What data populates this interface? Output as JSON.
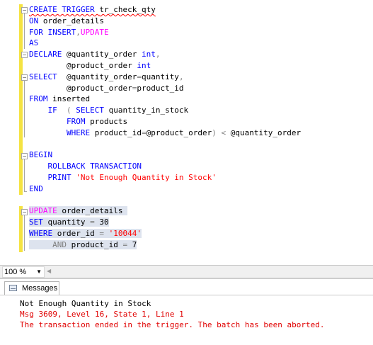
{
  "editor": {
    "lines": [
      [
        {
          "t": "CREATE TRIGGER ",
          "c": "kw",
          "sq": true
        },
        {
          "t": "tr_check_qty",
          "c": "",
          "sq": true
        }
      ],
      [
        {
          "t": "ON ",
          "c": "kw"
        },
        {
          "t": "order_details",
          "c": ""
        }
      ],
      [
        {
          "t": "FOR ",
          "c": "kw"
        },
        {
          "t": "INSERT",
          "c": "kw"
        },
        {
          "t": ",",
          "c": "gray"
        },
        {
          "t": "UPDATE",
          "c": "fn"
        }
      ],
      [
        {
          "t": "AS",
          "c": "kw"
        }
      ],
      [
        {
          "t": "DECLARE ",
          "c": "kw"
        },
        {
          "t": "@quantity_order ",
          "c": ""
        },
        {
          "t": "int",
          "c": "kw"
        },
        {
          "t": ",",
          "c": "gray"
        }
      ],
      [
        {
          "t": "        @product_order ",
          "c": ""
        },
        {
          "t": "int",
          "c": "kw"
        }
      ],
      [
        {
          "t": "SELECT  ",
          "c": "kw"
        },
        {
          "t": "@quantity_order",
          "c": ""
        },
        {
          "t": "=",
          "c": "gray"
        },
        {
          "t": "quantity",
          "c": ""
        },
        {
          "t": ",",
          "c": "gray"
        }
      ],
      [
        {
          "t": "        @product_order",
          "c": ""
        },
        {
          "t": "=",
          "c": "gray"
        },
        {
          "t": "product_id",
          "c": ""
        }
      ],
      [
        {
          "t": "FROM ",
          "c": "kw"
        },
        {
          "t": "inserted",
          "c": ""
        }
      ],
      [
        {
          "t": "    IF  ",
          "c": "kw"
        },
        {
          "t": "( ",
          "c": "gray"
        },
        {
          "t": "SELECT ",
          "c": "kw"
        },
        {
          "t": "quantity_in_stock",
          "c": ""
        }
      ],
      [
        {
          "t": "        FROM ",
          "c": "kw"
        },
        {
          "t": "products",
          "c": ""
        }
      ],
      [
        {
          "t": "        WHERE ",
          "c": "kw"
        },
        {
          "t": "product_id",
          "c": ""
        },
        {
          "t": "=",
          "c": "gray"
        },
        {
          "t": "@product_order",
          "c": ""
        },
        {
          "t": ") < ",
          "c": "gray"
        },
        {
          "t": "@quantity_order",
          "c": ""
        }
      ],
      [],
      [
        {
          "t": "BEGIN",
          "c": "kw"
        }
      ],
      [
        {
          "t": "    ROLLBACK TRANSACTION",
          "c": "kw"
        }
      ],
      [
        {
          "t": "    PRINT ",
          "c": "kw"
        },
        {
          "t": "'Not Enough Quantity in Stock'",
          "c": "str"
        }
      ],
      [
        {
          "t": "END",
          "c": "kw"
        }
      ],
      [],
      [
        {
          "t": "UPDATE ",
          "c": "fn",
          "hl": true
        },
        {
          "t": "order_details ",
          "c": "",
          "hl": true
        }
      ],
      [
        {
          "t": "SET ",
          "c": "kw",
          "hl": true
        },
        {
          "t": "quantity ",
          "c": "",
          "hl": true
        },
        {
          "t": "= ",
          "c": "gray",
          "hl": true
        },
        {
          "t": "30",
          "c": "",
          "hl": true
        }
      ],
      [
        {
          "t": "WHERE ",
          "c": "kw",
          "hl": true
        },
        {
          "t": "order_id ",
          "c": "",
          "hl": true
        },
        {
          "t": "= ",
          "c": "gray",
          "hl": true
        },
        {
          "t": "'10044'",
          "c": "str",
          "hl": true
        }
      ],
      [
        {
          "t": "     AND ",
          "c": "gray",
          "hl": true
        },
        {
          "t": "product_id ",
          "c": "",
          "hl": true
        },
        {
          "t": "= ",
          "c": "gray",
          "hl": true
        },
        {
          "t": "7",
          "c": "",
          "hl": true
        }
      ]
    ]
  },
  "zoom": {
    "value": "100 %"
  },
  "results": {
    "tab_label": "Messages",
    "messages": [
      {
        "text": "Not Enough Quantity in Stock",
        "type": "normal"
      },
      {
        "text": "Msg 3609, Level 16, State 1, Line 1",
        "type": "error"
      },
      {
        "text": "The transaction ended in the trigger. The batch has been aborted.",
        "type": "error"
      }
    ]
  },
  "icons": {
    "fold_collapse": "minus-box-icon",
    "zoom_dropdown": "chevron-down-icon",
    "scroll_left": "triangle-left-icon",
    "messages_tab": "messages-icon"
  },
  "colors": {
    "keyword": "#0000ff",
    "function": "#ff00ff",
    "string": "#ff0000",
    "operator": "#808080",
    "error": "#e00000",
    "change_bar": "#f5e342",
    "change_bar_saved": "#5fb55f"
  }
}
